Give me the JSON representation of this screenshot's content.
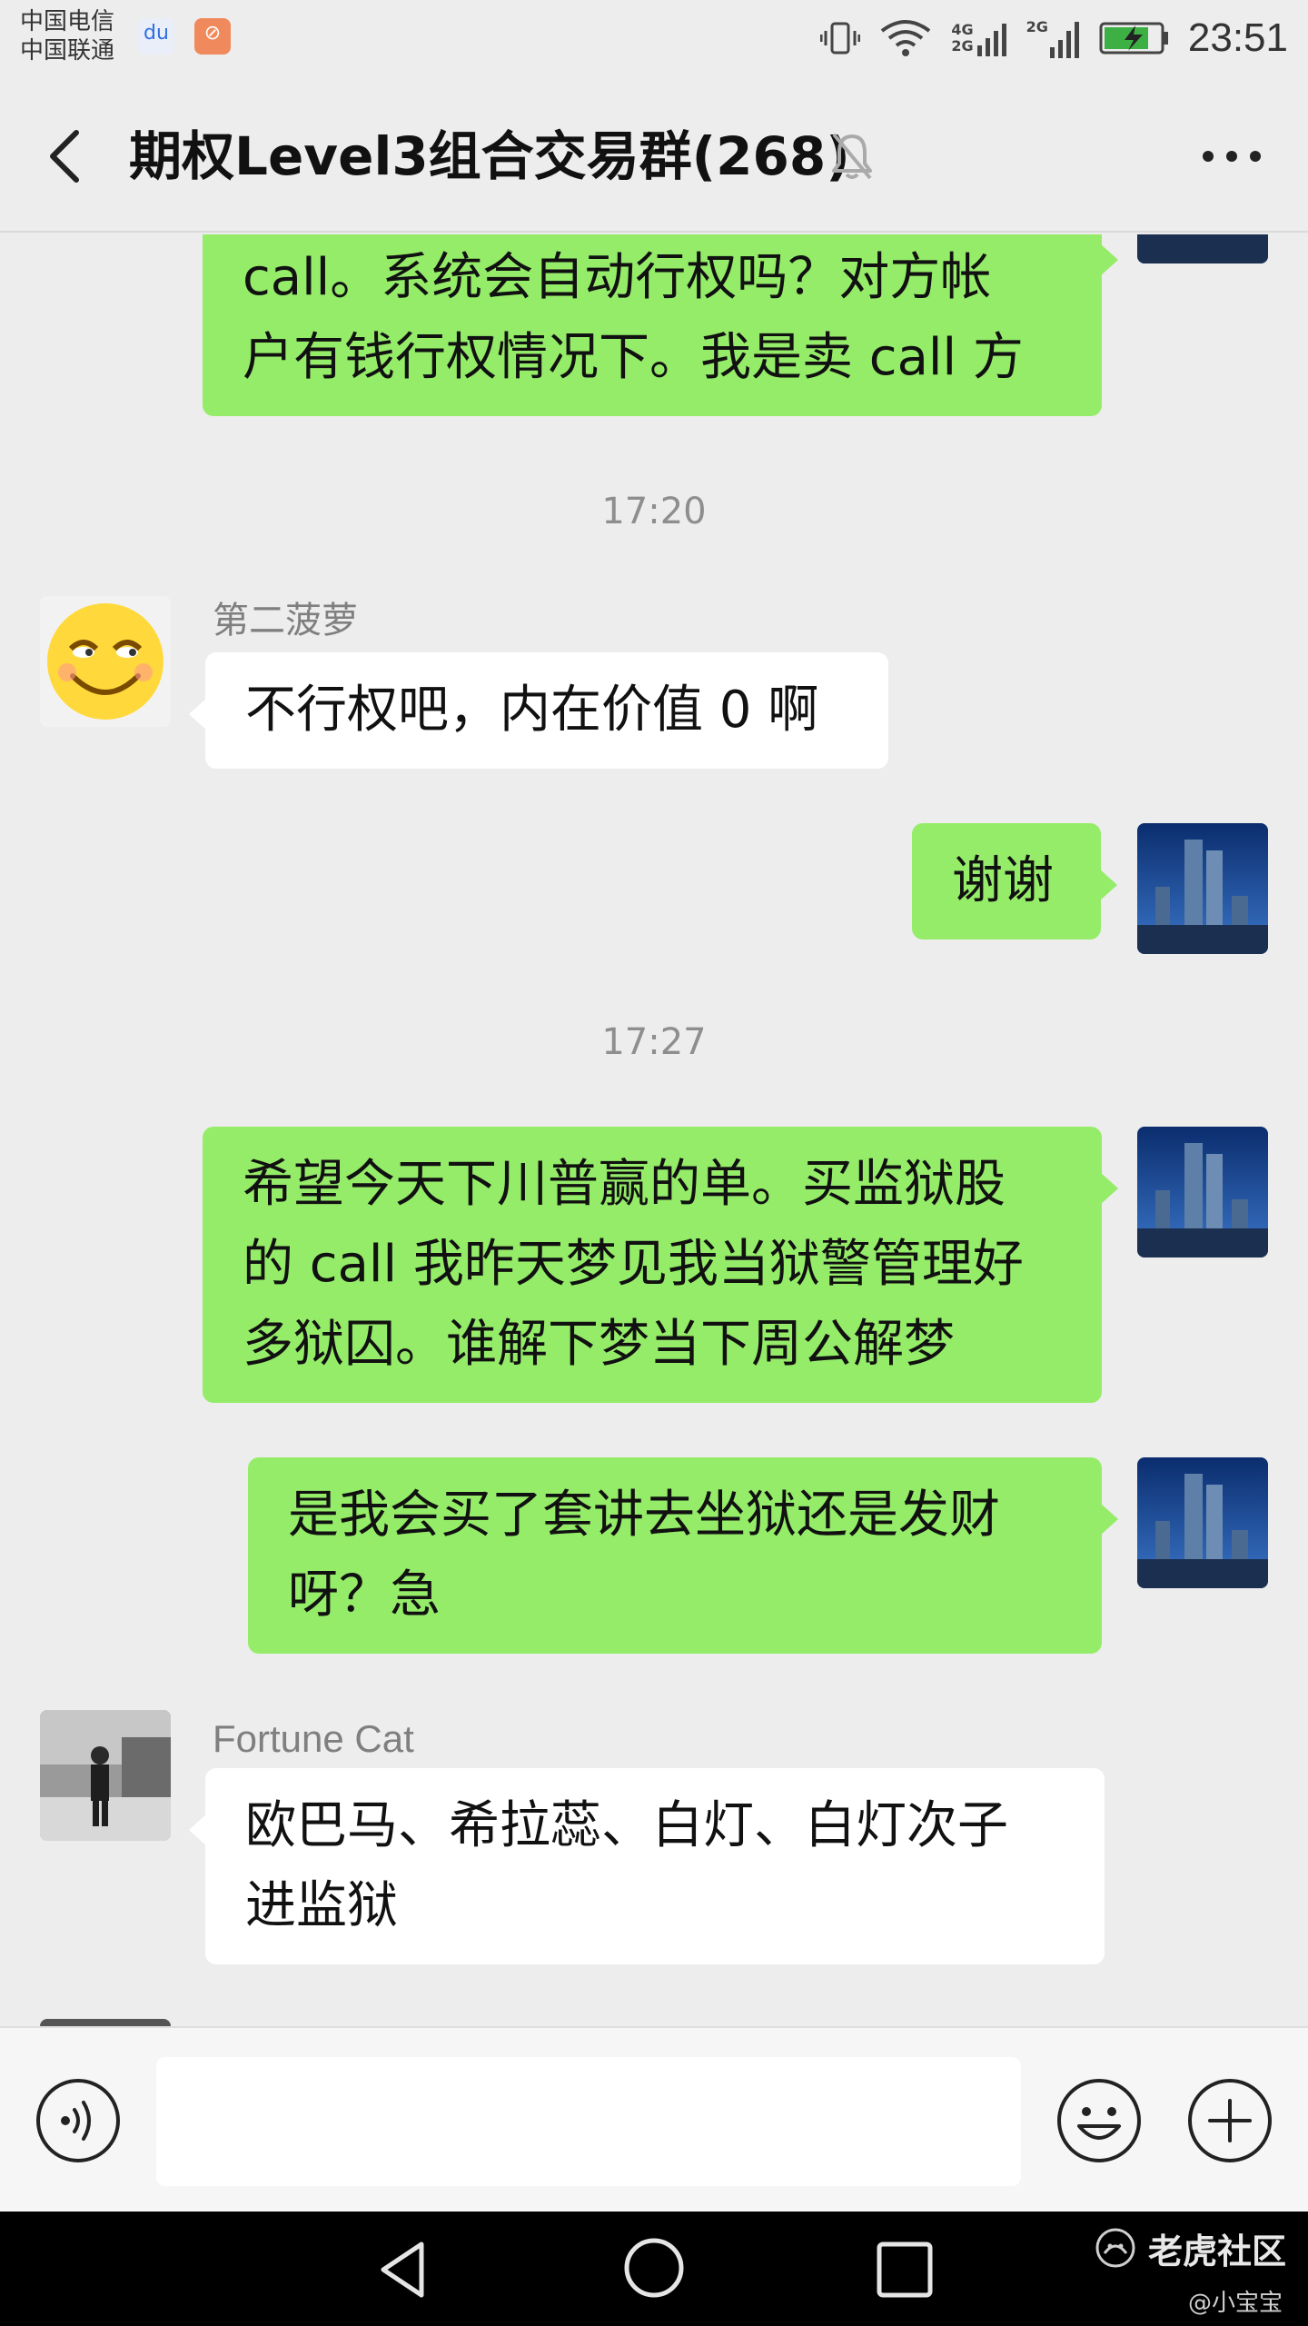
{
  "status_bar": {
    "carrier_1": "中国电信",
    "carrier_2": "中国联通",
    "network_1": "4G",
    "network_2": "2G",
    "network_3": "2G",
    "time": "23:51"
  },
  "header": {
    "title": "期权Level3组合交易群(268)"
  },
  "messages": [
    {
      "type": "me",
      "text": "call。系统会自动行权吗？对方帐\n户有钱行权情况下。我是卖 call 方"
    },
    {
      "type": "time",
      "text": "17:20"
    },
    {
      "type": "them",
      "sender": "第二菠萝",
      "text": "不行权吧，内在价值 0 啊"
    },
    {
      "type": "me",
      "text": "谢谢"
    },
    {
      "type": "time",
      "text": "17:27"
    },
    {
      "type": "me",
      "text": "希望今天下川普赢的单。买监狱股\n的 call 我昨天梦见我当狱警管理好\n多狱囚。谁解下梦当下周公解梦"
    },
    {
      "type": "me",
      "text": "是我会买了套讲去坐狱还是发财\n呀？急"
    },
    {
      "type": "them",
      "sender": "Fortune Cat",
      "text": "欧巴马、希拉蕊、白灯、白灯次子\n进监狱"
    }
  ],
  "input_bar": {
    "placeholder": "",
    "value": ""
  },
  "watermark": {
    "brand": "老虎社区",
    "handle": "@小宝宝"
  },
  "colors": {
    "background": "#ededed",
    "my_bubble": "#95ec69",
    "their_bubble": "#ffffff"
  }
}
